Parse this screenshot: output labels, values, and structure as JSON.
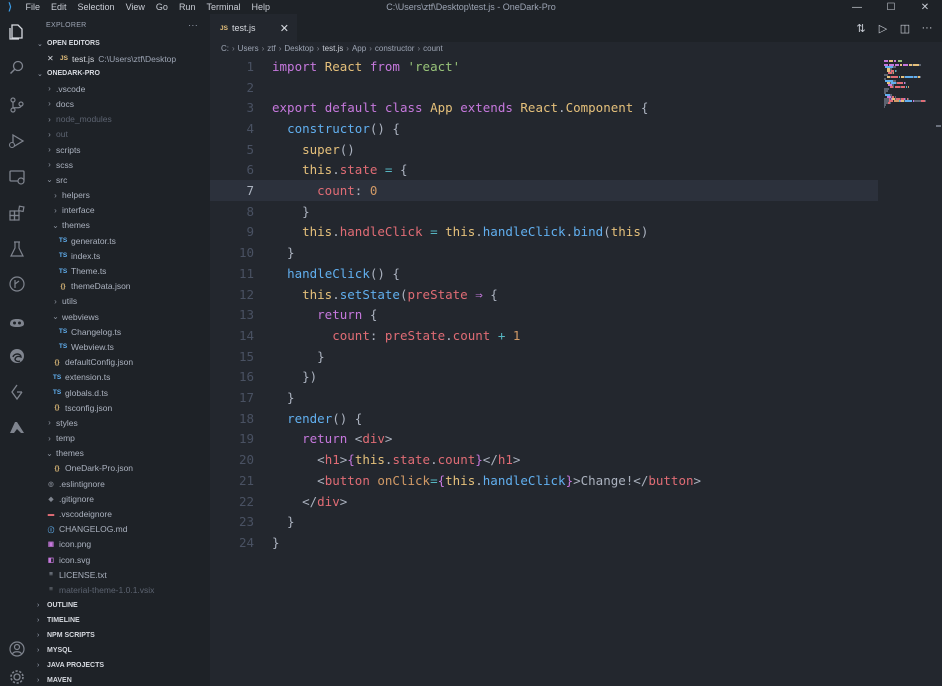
{
  "titlebar": {
    "menu": [
      "File",
      "Edit",
      "Selection",
      "View",
      "Go",
      "Run",
      "Terminal",
      "Help"
    ],
    "title": "C:\\Users\\ztf\\Desktop\\test.js - OneDark-Pro",
    "minimize": "—",
    "maximize": "☐",
    "close": "✕"
  },
  "activity_icons": [
    "explorer-icon",
    "search-icon",
    "source-control-icon",
    "run-debug-icon",
    "remote-explorer-icon",
    "extensions-icon",
    "testing-icon",
    "gitlens-icon",
    "github-copilot-icon",
    "edge-devtools-icon",
    "git-graph-icon",
    "azure-icon",
    "account-icon",
    "settings-icon"
  ],
  "sidebar": {
    "header": "EXPLORER",
    "more": "···",
    "open_editors_label": "OPEN EDITORS",
    "open_editor": {
      "close": "✕",
      "badge": "JS",
      "name": "test.js",
      "path": "C:\\Users\\ztf\\Desktop"
    },
    "project_label": "ONEDARK-PRO",
    "tree": [
      {
        "indent": 1,
        "chev": "›",
        "icon": "",
        "type": "folder",
        "label": ".vscode"
      },
      {
        "indent": 1,
        "chev": "›",
        "icon": "",
        "type": "folder",
        "label": "docs"
      },
      {
        "indent": 1,
        "chev": "›",
        "icon": "",
        "type": "folder-dim",
        "label": "node_modules"
      },
      {
        "indent": 1,
        "chev": "›",
        "icon": "",
        "type": "folder-dim",
        "label": "out"
      },
      {
        "indent": 1,
        "chev": "›",
        "icon": "",
        "type": "folder",
        "label": "scripts"
      },
      {
        "indent": 1,
        "chev": "›",
        "icon": "",
        "type": "folder",
        "label": "scss"
      },
      {
        "indent": 1,
        "chev": "⌄",
        "icon": "",
        "type": "folder",
        "label": "src"
      },
      {
        "indent": 2,
        "chev": "›",
        "icon": "",
        "type": "folder",
        "label": "helpers"
      },
      {
        "indent": 2,
        "chev": "›",
        "icon": "",
        "type": "folder",
        "label": "interface"
      },
      {
        "indent": 2,
        "chev": "⌄",
        "icon": "",
        "type": "folder",
        "label": "themes"
      },
      {
        "indent": 3,
        "chev": "",
        "icon": "TS",
        "type": "ts",
        "label": "generator.ts"
      },
      {
        "indent": 3,
        "chev": "",
        "icon": "TS",
        "type": "ts",
        "label": "index.ts"
      },
      {
        "indent": 3,
        "chev": "",
        "icon": "TS",
        "type": "ts",
        "label": "Theme.ts"
      },
      {
        "indent": 3,
        "chev": "",
        "icon": "{}",
        "type": "json",
        "label": "themeData.json"
      },
      {
        "indent": 2,
        "chev": "›",
        "icon": "",
        "type": "folder",
        "label": "utils"
      },
      {
        "indent": 2,
        "chev": "⌄",
        "icon": "",
        "type": "folder",
        "label": "webviews"
      },
      {
        "indent": 3,
        "chev": "",
        "icon": "TS",
        "type": "ts",
        "label": "Changelog.ts"
      },
      {
        "indent": 3,
        "chev": "",
        "icon": "TS",
        "type": "ts",
        "label": "Webview.ts"
      },
      {
        "indent": 2,
        "chev": "",
        "icon": "{}",
        "type": "json",
        "label": "defaultConfig.json"
      },
      {
        "indent": 2,
        "chev": "",
        "icon": "TS",
        "type": "ts",
        "label": "extension.ts"
      },
      {
        "indent": 2,
        "chev": "",
        "icon": "TS",
        "type": "ts",
        "label": "globals.d.ts"
      },
      {
        "indent": 2,
        "chev": "",
        "icon": "{}",
        "type": "json",
        "label": "tsconfig.json"
      },
      {
        "indent": 1,
        "chev": "›",
        "icon": "",
        "type": "folder",
        "label": "styles"
      },
      {
        "indent": 1,
        "chev": "›",
        "icon": "",
        "type": "folder",
        "label": "temp"
      },
      {
        "indent": 1,
        "chev": "⌄",
        "icon": "",
        "type": "folder",
        "label": "themes"
      },
      {
        "indent": 2,
        "chev": "",
        "icon": "{}",
        "type": "json",
        "label": "OneDark-Pro.json"
      },
      {
        "indent": 1,
        "chev": "",
        "icon": "◎",
        "type": "eslint",
        "label": ".eslintignore"
      },
      {
        "indent": 1,
        "chev": "",
        "icon": "◆",
        "type": "git",
        "label": ".gitignore"
      },
      {
        "indent": 1,
        "chev": "",
        "icon": "▬",
        "type": "vsc",
        "label": ".vscodeignore"
      },
      {
        "indent": 1,
        "chev": "",
        "icon": "ⓘ",
        "type": "md",
        "label": "CHANGELOG.md"
      },
      {
        "indent": 1,
        "chev": "",
        "icon": "▣",
        "type": "png",
        "label": "icon.png"
      },
      {
        "indent": 1,
        "chev": "",
        "icon": "◧",
        "type": "svg",
        "label": "icon.svg"
      },
      {
        "indent": 1,
        "chev": "",
        "icon": "≡",
        "type": "txt",
        "label": "LICENSE.txt"
      },
      {
        "indent": 1,
        "chev": "",
        "icon": "≡",
        "type": "vsix",
        "label": "material-theme-1.0.1.vsix"
      }
    ],
    "bottom_sections": [
      "OUTLINE",
      "TIMELINE",
      "NPM SCRIPTS",
      "MYSQL",
      "JAVA PROJECTS",
      "MAVEN"
    ]
  },
  "tab": {
    "badge": "JS",
    "name": "test.js",
    "close": "✕"
  },
  "tab_actions": [
    "⇅",
    "▷",
    "◫",
    "···"
  ],
  "breadcrumb": [
    "C:",
    "Users",
    "ztf",
    "Desktop",
    "test.js",
    "App",
    "constructor",
    "count"
  ],
  "breadcrumb_sep": "›",
  "editor": {
    "current_line": 7,
    "lines": [
      [
        [
          "kw",
          "import"
        ],
        [
          "pl",
          " "
        ],
        [
          "cls",
          "React"
        ],
        [
          "pl",
          " "
        ],
        [
          "kw",
          "from"
        ],
        [
          "pl",
          " "
        ],
        [
          "str",
          "'react'"
        ]
      ],
      [],
      [
        [
          "kw",
          "export"
        ],
        [
          "pl",
          " "
        ],
        [
          "kw",
          "default"
        ],
        [
          "pl",
          " "
        ],
        [
          "kw",
          "class"
        ],
        [
          "pl",
          " "
        ],
        [
          "cls",
          "App"
        ],
        [
          "pl",
          " "
        ],
        [
          "kw",
          "extends"
        ],
        [
          "pl",
          " "
        ],
        [
          "cls",
          "React"
        ],
        [
          "pl",
          "."
        ],
        [
          "cls",
          "Component"
        ],
        [
          "pl",
          " {"
        ]
      ],
      [
        [
          "pl",
          "  "
        ],
        [
          "fn",
          "constructor"
        ],
        [
          "pl",
          "() {"
        ]
      ],
      [
        [
          "pl",
          "    "
        ],
        [
          "cls",
          "super"
        ],
        [
          "pl",
          "()"
        ]
      ],
      [
        [
          "pl",
          "    "
        ],
        [
          "this",
          "this"
        ],
        [
          "pl",
          "."
        ],
        [
          "prop",
          "state"
        ],
        [
          "pl",
          " "
        ],
        [
          "op",
          "="
        ],
        [
          "pl",
          " {"
        ]
      ],
      [
        [
          "pl",
          "      "
        ],
        [
          "prop",
          "count"
        ],
        [
          "pl",
          ": "
        ],
        [
          "num",
          "0"
        ]
      ],
      [
        [
          "pl",
          "    }"
        ]
      ],
      [
        [
          "pl",
          "    "
        ],
        [
          "this",
          "this"
        ],
        [
          "pl",
          "."
        ],
        [
          "prop",
          "handleClick"
        ],
        [
          "pl",
          " "
        ],
        [
          "op",
          "="
        ],
        [
          "pl",
          " "
        ],
        [
          "this",
          "this"
        ],
        [
          "pl",
          "."
        ],
        [
          "fn",
          "handleClick"
        ],
        [
          "pl",
          "."
        ],
        [
          "fn",
          "bind"
        ],
        [
          "pl",
          "("
        ],
        [
          "this",
          "this"
        ],
        [
          "pl",
          ")"
        ]
      ],
      [
        [
          "pl",
          "  }"
        ]
      ],
      [
        [
          "pl",
          "  "
        ],
        [
          "fn",
          "handleClick"
        ],
        [
          "pl",
          "() {"
        ]
      ],
      [
        [
          "pl",
          "    "
        ],
        [
          "this",
          "this"
        ],
        [
          "pl",
          "."
        ],
        [
          "fn",
          "setState"
        ],
        [
          "pl",
          "("
        ],
        [
          "prop",
          "preState"
        ],
        [
          "pl",
          " "
        ],
        [
          "kw",
          "⇒"
        ],
        [
          "pl",
          " {"
        ]
      ],
      [
        [
          "pl",
          "      "
        ],
        [
          "kw",
          "return"
        ],
        [
          "pl",
          " {"
        ]
      ],
      [
        [
          "pl",
          "        "
        ],
        [
          "prop",
          "count"
        ],
        [
          "pl",
          ": "
        ],
        [
          "prop",
          "preState"
        ],
        [
          "pl",
          "."
        ],
        [
          "prop",
          "count"
        ],
        [
          "pl",
          " "
        ],
        [
          "op",
          "+"
        ],
        [
          "pl",
          " "
        ],
        [
          "num",
          "1"
        ]
      ],
      [
        [
          "pl",
          "      }"
        ]
      ],
      [
        [
          "pl",
          "    })"
        ]
      ],
      [
        [
          "pl",
          "  }"
        ]
      ],
      [
        [
          "pl",
          "  "
        ],
        [
          "fn",
          "render"
        ],
        [
          "pl",
          "() {"
        ]
      ],
      [
        [
          "pl",
          "    "
        ],
        [
          "kw",
          "return"
        ],
        [
          "pl",
          " <"
        ],
        [
          "tag",
          "div"
        ],
        [
          "pl",
          ">"
        ]
      ],
      [
        [
          "pl",
          "      <"
        ],
        [
          "tag",
          "h1"
        ],
        [
          "pl",
          ">"
        ],
        [
          "brace",
          "{"
        ],
        [
          "this",
          "this"
        ],
        [
          "pl",
          "."
        ],
        [
          "prop",
          "state"
        ],
        [
          "pl",
          "."
        ],
        [
          "prop",
          "count"
        ],
        [
          "brace",
          "}"
        ],
        [
          "pl",
          "</"
        ],
        [
          "tag",
          "h1"
        ],
        [
          "pl",
          ">"
        ]
      ],
      [
        [
          "pl",
          "      <"
        ],
        [
          "tag",
          "button"
        ],
        [
          "pl",
          " "
        ],
        [
          "attr",
          "onClick"
        ],
        [
          "op",
          "="
        ],
        [
          "brace",
          "{"
        ],
        [
          "this",
          "this"
        ],
        [
          "pl",
          "."
        ],
        [
          "fn",
          "handleClick"
        ],
        [
          "brace",
          "}"
        ],
        [
          "pl",
          ">Change!</"
        ],
        [
          "tag",
          "button"
        ],
        [
          "pl",
          ">"
        ]
      ],
      [
        [
          "pl",
          "    </"
        ],
        [
          "tag",
          "div"
        ],
        [
          "pl",
          ">"
        ]
      ],
      [
        [
          "pl",
          "  }"
        ]
      ],
      [
        [
          "pl",
          "}"
        ]
      ]
    ]
  },
  "colors": {
    "background": "#23272e",
    "sidebar": "#1e2227",
    "keyword": "#c678dd",
    "string": "#98c379",
    "class": "#e5c07b",
    "function": "#61afef",
    "property": "#e06c75",
    "number": "#d19a66",
    "operator": "#56b6c2"
  }
}
